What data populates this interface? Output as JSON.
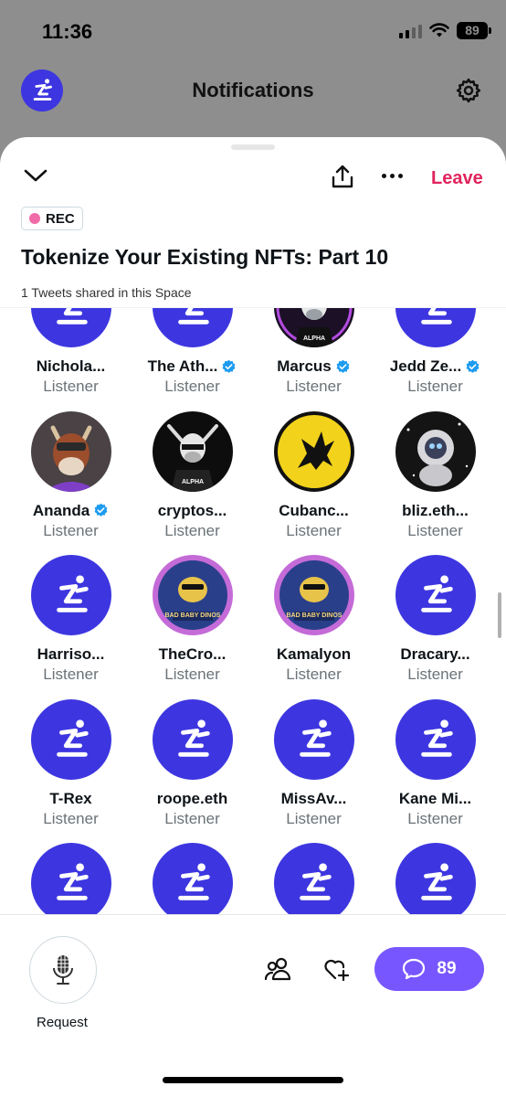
{
  "status_bar": {
    "time": "11:36",
    "battery": "89"
  },
  "header": {
    "title": "Notifications"
  },
  "sheet": {
    "leave_label": "Leave",
    "rec_label": "REC",
    "title": "Tokenize Your Existing NFTs: Part 10",
    "tweets_shared": "1 Tweets shared in this Space"
  },
  "listeners": [
    {
      "name": "Nichola...",
      "role": "Listener",
      "verified": false,
      "avatar": "default"
    },
    {
      "name": "The Ath...",
      "role": "Listener",
      "verified": true,
      "avatar": "default"
    },
    {
      "name": "Marcus",
      "role": "Listener",
      "verified": true,
      "avatar": "bull-alpha"
    },
    {
      "name": "Jedd Ze...",
      "role": "Listener",
      "verified": true,
      "avatar": "default"
    },
    {
      "name": "Ananda",
      "role": "Listener",
      "verified": true,
      "avatar": "beast"
    },
    {
      "name": "cryptos...",
      "role": "Listener",
      "verified": false,
      "avatar": "bull-alpha-dark"
    },
    {
      "name": "Cubanc...",
      "role": "Listener",
      "verified": false,
      "avatar": "pegasus"
    },
    {
      "name": "bliz.eth...",
      "role": "Listener",
      "verified": false,
      "avatar": "astronaut"
    },
    {
      "name": "Harriso...",
      "role": "Listener",
      "verified": false,
      "avatar": "default"
    },
    {
      "name": "TheCro...",
      "role": "Listener",
      "verified": false,
      "avatar": "bad-baby-dinos"
    },
    {
      "name": "Kamalyon",
      "role": "Listener",
      "verified": false,
      "avatar": "bad-baby-dinos"
    },
    {
      "name": "Dracary...",
      "role": "Listener",
      "verified": false,
      "avatar": "default"
    },
    {
      "name": "T-Rex",
      "role": "Listener",
      "verified": false,
      "avatar": "default"
    },
    {
      "name": "roope.eth",
      "role": "Listener",
      "verified": false,
      "avatar": "default"
    },
    {
      "name": "MissAv...",
      "role": "Listener",
      "verified": false,
      "avatar": "default"
    },
    {
      "name": "Kane Mi...",
      "role": "Listener",
      "verified": false,
      "avatar": "default"
    },
    {
      "name": "",
      "role": "",
      "verified": false,
      "avatar": "default"
    },
    {
      "name": "",
      "role": "",
      "verified": false,
      "avatar": "default"
    },
    {
      "name": "",
      "role": "",
      "verified": false,
      "avatar": "default"
    },
    {
      "name": "",
      "role": "",
      "verified": false,
      "avatar": "default"
    }
  ],
  "avatar_badge_text": {
    "alpha": "ALPHA",
    "dinos": "BAD BABY DINOS"
  },
  "bottom_bar": {
    "request_label": "Request",
    "chat_count": "89"
  },
  "colors": {
    "accent_purple": "#7856ff",
    "default_avatar": "#3d36e0",
    "leave_red": "#e0245e",
    "verified_blue": "#1d9bf0"
  }
}
